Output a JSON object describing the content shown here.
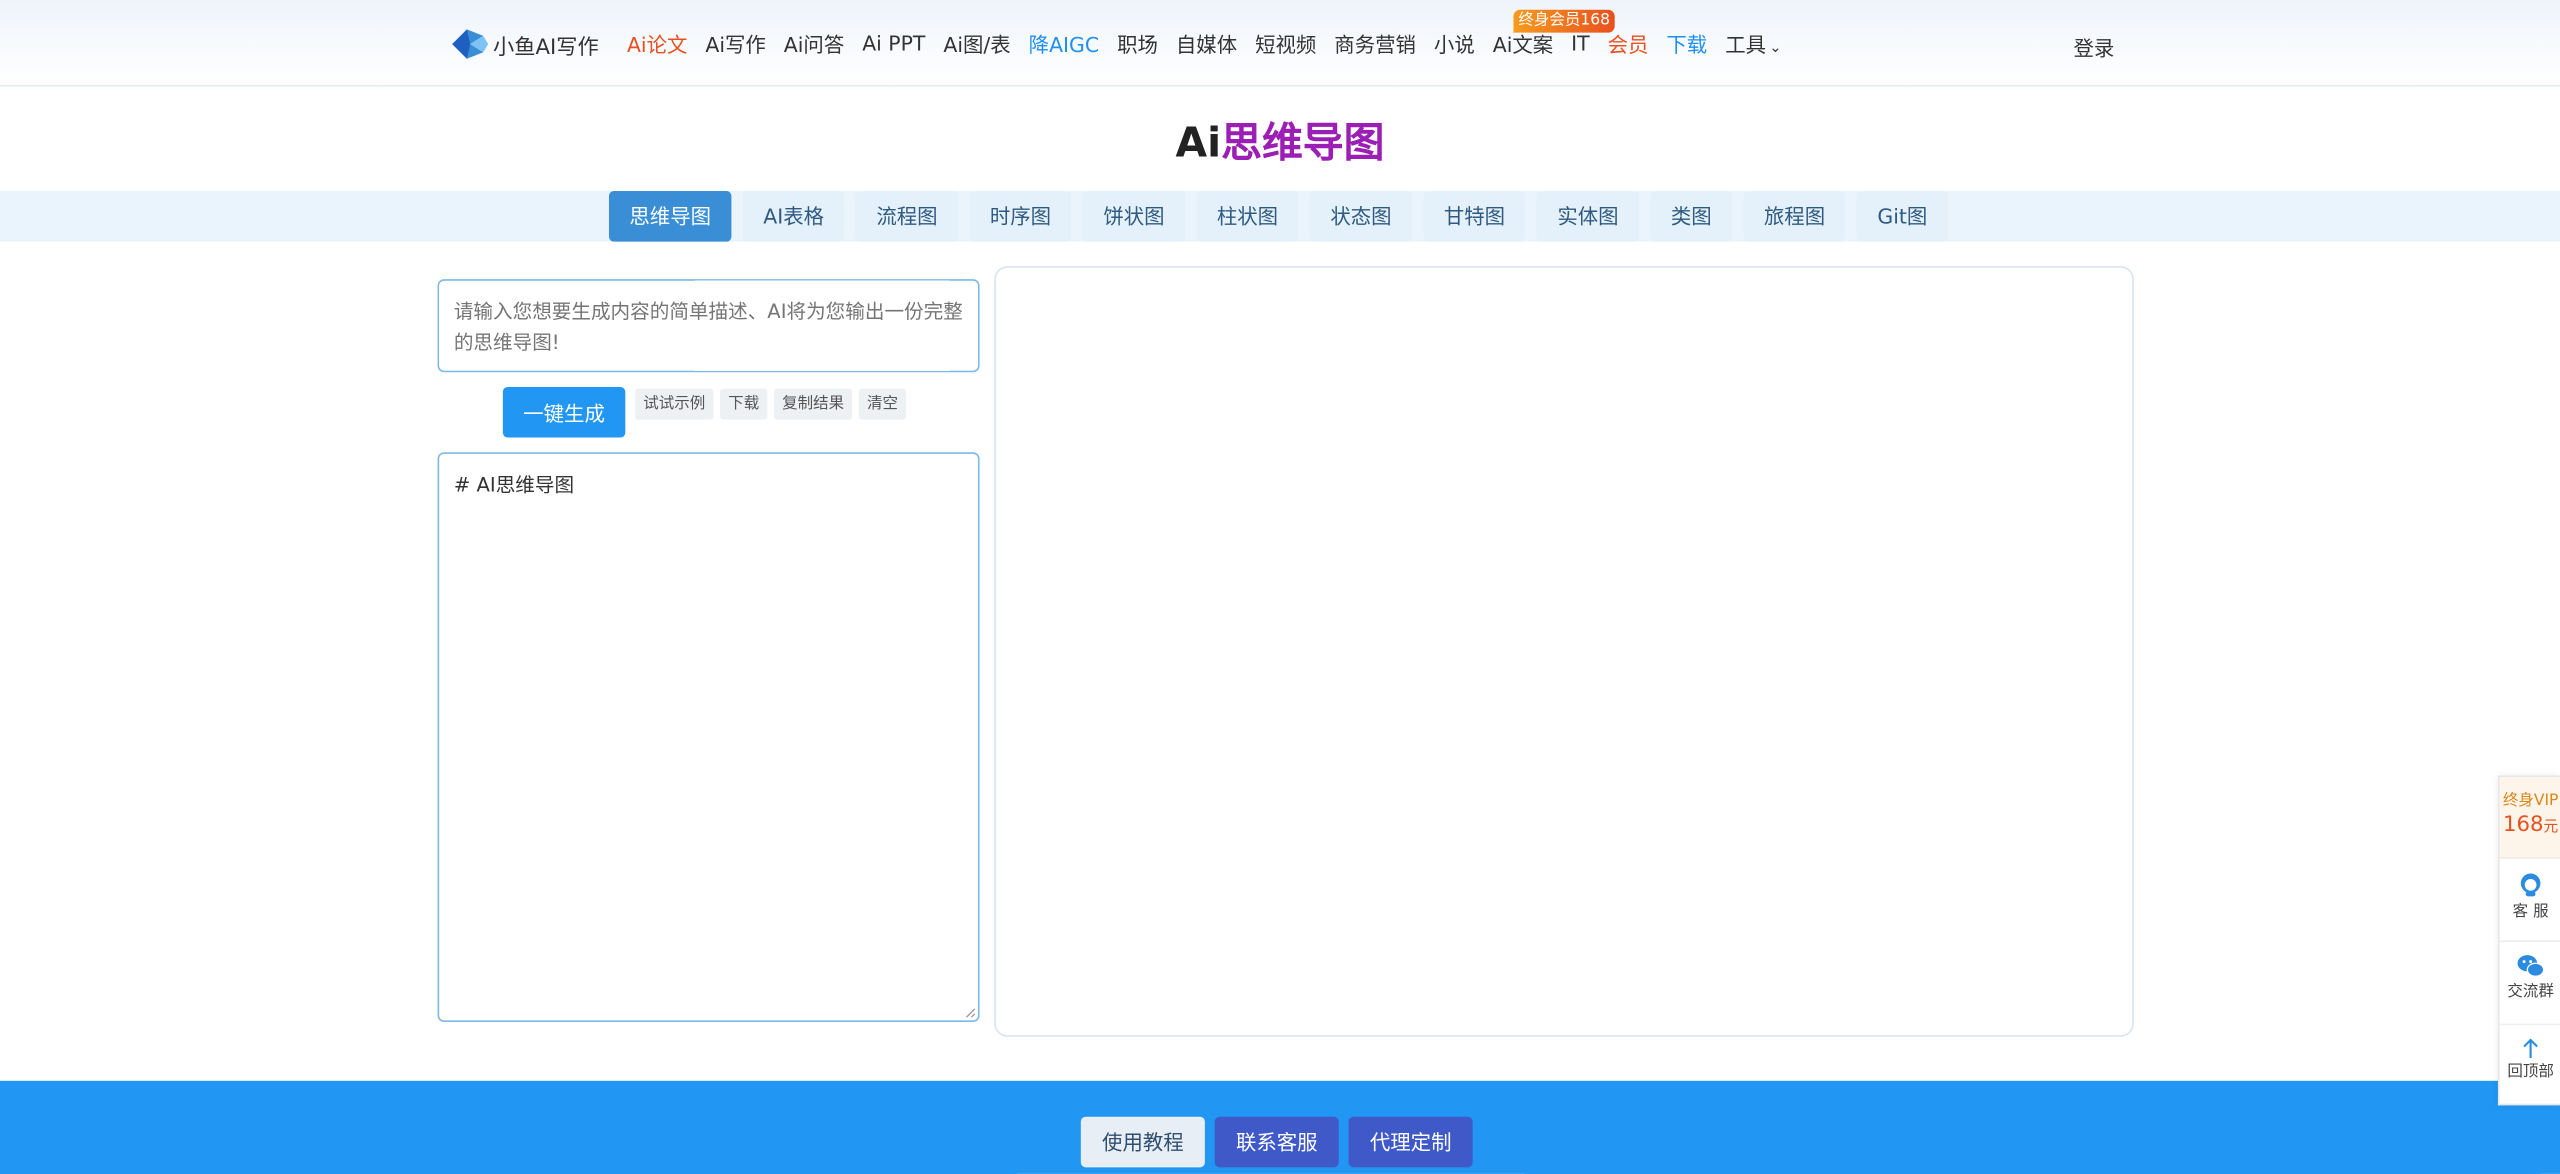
{
  "header": {
    "logo_text": "小鱼AI写作",
    "nav": [
      {
        "label": "Ai论文",
        "style": "red"
      },
      {
        "label": "Ai写作",
        "style": ""
      },
      {
        "label": "Ai问答",
        "style": ""
      },
      {
        "label": "Ai PPT",
        "style": ""
      },
      {
        "label": "Ai图/表",
        "style": ""
      },
      {
        "label": "降AIGC",
        "style": "blue"
      },
      {
        "label": "职场",
        "style": ""
      },
      {
        "label": "自媒体",
        "style": ""
      },
      {
        "label": "短视频",
        "style": ""
      },
      {
        "label": "商务营销",
        "style": ""
      },
      {
        "label": "小说",
        "style": ""
      },
      {
        "label": "Ai文案",
        "style": ""
      },
      {
        "label": "IT",
        "style": ""
      },
      {
        "label": "会员",
        "style": "red"
      },
      {
        "label": "下载",
        "style": "blue"
      },
      {
        "label": "工具",
        "style": "",
        "dropdown": true
      }
    ],
    "vip_badge": "终身会员168",
    "login": "登录"
  },
  "title": {
    "prefix": "Ai",
    "main": "思维导图"
  },
  "tabs": [
    {
      "label": "思维导图",
      "active": true
    },
    {
      "label": "AI表格"
    },
    {
      "label": "流程图"
    },
    {
      "label": "时序图"
    },
    {
      "label": "饼状图"
    },
    {
      "label": "柱状图"
    },
    {
      "label": "状态图"
    },
    {
      "label": "甘特图"
    },
    {
      "label": "实体图"
    },
    {
      "label": "类图"
    },
    {
      "label": "旅程图"
    },
    {
      "label": "Git图"
    }
  ],
  "prompt": {
    "placeholder": "请输入您想要生成内容的简单描述、AI将为您输出一份完整的思维导图!",
    "value": ""
  },
  "actions": {
    "generate": "一键生成",
    "example": "试试示例",
    "download": "下载",
    "copy": "复制结果",
    "clear": "清空"
  },
  "editor": {
    "content": "# AI思维导图"
  },
  "footer": {
    "tutorial": "使用教程",
    "contact": "联系客服",
    "agent": "代理定制"
  },
  "side": {
    "vip_line1": "终身VIP",
    "vip_price": "168",
    "vip_unit": "元",
    "service": "客 服",
    "group": "交流群",
    "top": "回顶部"
  },
  "colors": {
    "accent": "#2196f3",
    "title_main": "#9b1fb5",
    "red": "#e8501f"
  }
}
